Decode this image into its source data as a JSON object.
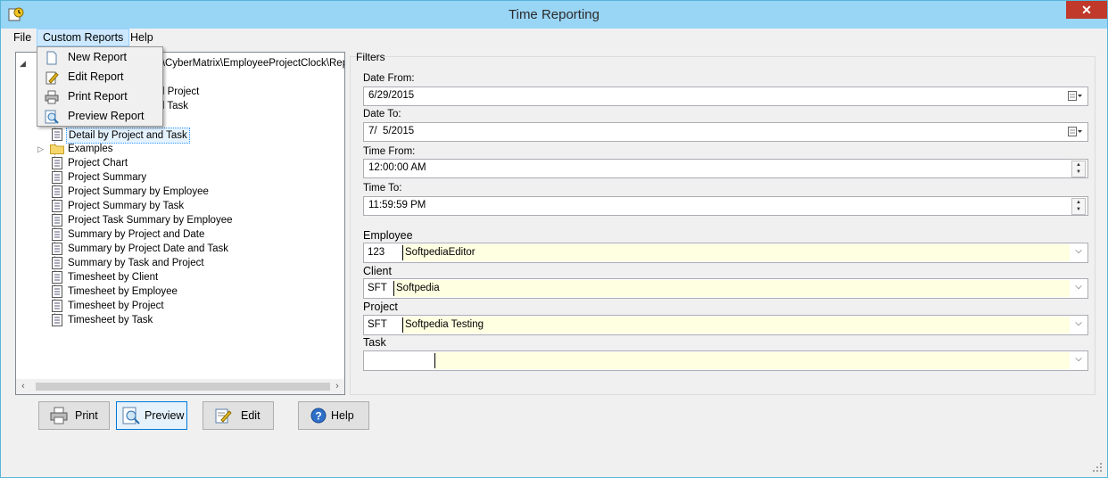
{
  "window": {
    "title": "Time Reporting",
    "close_label": "✕"
  },
  "menubar": {
    "items": [
      "File",
      "Custom Reports",
      "Help"
    ]
  },
  "dropdown": {
    "items": [
      "New Report",
      "Edit Report",
      "Print Report",
      "Preview Report"
    ]
  },
  "tree": {
    "partial_path": "s\\CyberMatrix\\EmployeeProjectClock\\Repo",
    "partial_items": [
      "d Project",
      "d Task"
    ],
    "selected": "Detail by Project and Task",
    "folder": "Examples",
    "items": [
      "Project Chart",
      "Project Summary",
      "Project Summary by Employee",
      "Project Summary by Task",
      "Project Task Summary by Employee",
      "Summary by Project and Date",
      "Summary by Project Date and Task",
      "Summary by Task and Project",
      "Timesheet by Client",
      "Timesheet by Employee",
      "Timesheet by Project",
      "Timesheet by Task"
    ]
  },
  "filters": {
    "title": "Filters",
    "date_from": {
      "label": "Date From:",
      "value": "6/29/2015"
    },
    "date_to": {
      "label": "Date To:",
      "value": "7/  5/2015"
    },
    "time_from": {
      "label": "Time From:",
      "value": "12:00:00 AM"
    },
    "time_to": {
      "label": "Time To:",
      "value": "11:59:59 PM"
    },
    "employee": {
      "label": "Employee",
      "code": "123",
      "name": "SoftpediaEditor"
    },
    "client": {
      "label": "Client",
      "code": "SFT",
      "name": "Softpedia"
    },
    "project": {
      "label": "Project",
      "code": "SFT",
      "name": "Softpedia Testing"
    },
    "task": {
      "label": "Task",
      "code": "",
      "name": ""
    }
  },
  "buttons": {
    "print": "Print",
    "preview": "Preview",
    "edit": "Edit",
    "help": "Help"
  }
}
